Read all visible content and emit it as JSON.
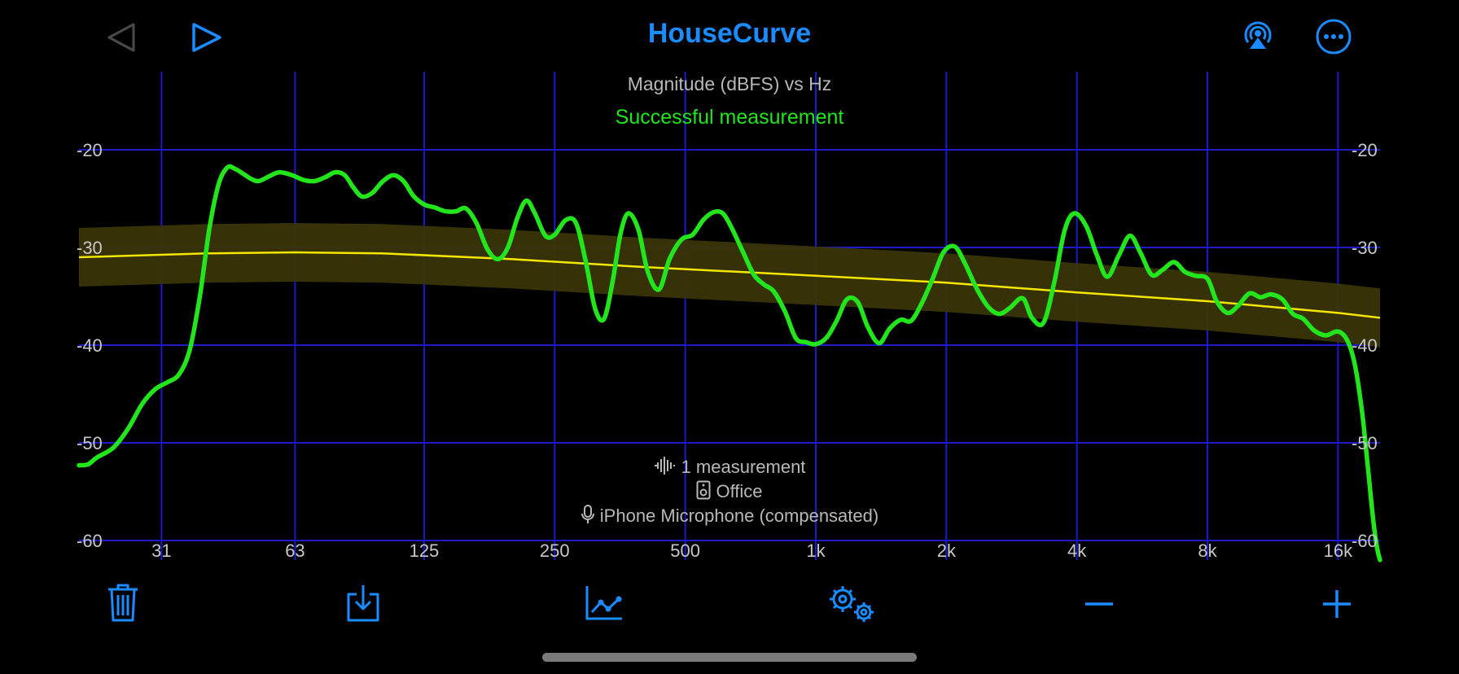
{
  "app": {
    "title": "HouseCurve"
  },
  "chart_data": {
    "type": "line",
    "title": "Magnitude (dBFS) vs Hz",
    "status": "Successful measurement",
    "xscale": "log",
    "xlim": [
      20,
      20000
    ],
    "ylim": [
      -62,
      -12
    ],
    "x_ticks": [
      {
        "value": 31,
        "label": "31"
      },
      {
        "value": 63,
        "label": "63"
      },
      {
        "value": 125,
        "label": "125"
      },
      {
        "value": 250,
        "label": "250"
      },
      {
        "value": 500,
        "label": "500"
      },
      {
        "value": 1000,
        "label": "1k"
      },
      {
        "value": 2000,
        "label": "2k"
      },
      {
        "value": 4000,
        "label": "4k"
      },
      {
        "value": 8000,
        "label": "8k"
      },
      {
        "value": 16000,
        "label": "16k"
      }
    ],
    "y_ticks": [
      {
        "value": -20,
        "label": "-20"
      },
      {
        "value": -30,
        "label": "-30"
      },
      {
        "value": -40,
        "label": "-40"
      },
      {
        "value": -50,
        "label": "-50"
      },
      {
        "value": -60,
        "label": "-60"
      }
    ],
    "grid": true,
    "colors": {
      "grid": "#1a1acc",
      "measurement": "#22e51c",
      "target": "#f5e600",
      "band": "#3a3408"
    },
    "target": {
      "x": [
        20,
        40,
        63,
        100,
        200,
        400,
        1000,
        2000,
        4000,
        8000,
        16000,
        20000
      ],
      "y": [
        -31,
        -30.6,
        -30.5,
        -30.6,
        -31.2,
        -32,
        -32.9,
        -33.6,
        -34.6,
        -35.5,
        -36.7,
        -37.2
      ]
    },
    "band": {
      "upper_offset": 3,
      "lower_offset": 3
    },
    "measurement": {
      "x": [
        20,
        21,
        22,
        24,
        26,
        28,
        30,
        32,
        34,
        36,
        38,
        40,
        42,
        44,
        46,
        48,
        50,
        52,
        55,
        58,
        62,
        66,
        70,
        74,
        78,
        82,
        86,
        90,
        95,
        100,
        106,
        112,
        118,
        125,
        132,
        140,
        148,
        156,
        165,
        175,
        185,
        195,
        205,
        215,
        225,
        238,
        250,
        265,
        280,
        295,
        310,
        325,
        340,
        355,
        370,
        390,
        410,
        435,
        460,
        490,
        520,
        550,
        580,
        610,
        640,
        680,
        720,
        760,
        800,
        850,
        900,
        950,
        1000,
        1060,
        1120,
        1180,
        1250,
        1320,
        1400,
        1480,
        1570,
        1660,
        1760,
        1860,
        1970,
        2090,
        2200,
        2350,
        2500,
        2650,
        2800,
        3000,
        3150,
        3350,
        3550,
        3750,
        3950,
        4200,
        4450,
        4700,
        5000,
        5300,
        5600,
        5950,
        6300,
        6700,
        7100,
        7500,
        8000,
        8400,
        8900,
        9400,
        10000,
        10600,
        11200,
        11900,
        12600,
        13300,
        14100,
        15000,
        16000,
        16800,
        17500,
        18200,
        18800,
        19300,
        19700,
        20000
      ],
      "y": [
        -52.3,
        -52.2,
        -51.5,
        -50.5,
        -48.5,
        -46,
        -44.5,
        -43.8,
        -43,
        -40.5,
        -35,
        -28,
        -23.5,
        -21.8,
        -22,
        -22.5,
        -23,
        -23.2,
        -22.7,
        -22.3,
        -22.6,
        -23.1,
        -23.2,
        -22.8,
        -22.3,
        -22.6,
        -23.9,
        -24.8,
        -24.4,
        -23.3,
        -22.6,
        -23.2,
        -24.7,
        -25.6,
        -25.9,
        -26.3,
        -26.3,
        -26,
        -27.5,
        -30.2,
        -31.2,
        -30,
        -27,
        -25.2,
        -26.5,
        -28.8,
        -28.7,
        -27.2,
        -27.5,
        -31.5,
        -36.3,
        -37.3,
        -33.5,
        -28.5,
        -26.5,
        -28.2,
        -32.5,
        -34.3,
        -31.2,
        -29.2,
        -28.7,
        -27.2,
        -26.4,
        -26.5,
        -28,
        -30.5,
        -32.8,
        -33.8,
        -34.5,
        -36.6,
        -39.3,
        -39.7,
        -39.9,
        -39.2,
        -37.4,
        -35.3,
        -35.6,
        -38.2,
        -39.8,
        -38.3,
        -37.4,
        -37.5,
        -35.6,
        -33.2,
        -30.5,
        -29.9,
        -31.5,
        -34.2,
        -36.1,
        -36.8,
        -36.2,
        -35.2,
        -37.2,
        -37.7,
        -33.5,
        -28.2,
        -26.5,
        -27.8,
        -30.8,
        -33,
        -30.8,
        -28.8,
        -30.5,
        -32.8,
        -32.3,
        -31.5,
        -32.5,
        -32.9,
        -33.2,
        -35.5,
        -36.7,
        -36,
        -34.7,
        -35.1,
        -34.8,
        -35.3,
        -36.8,
        -37.3,
        -38.5,
        -39,
        -38.6,
        -39.5,
        -42,
        -47,
        -53,
        -58,
        -60.8,
        -62
      ]
    }
  },
  "info": {
    "measurements": "1 measurement",
    "location": "Office",
    "microphone": "iPhone Microphone (compensated)"
  }
}
